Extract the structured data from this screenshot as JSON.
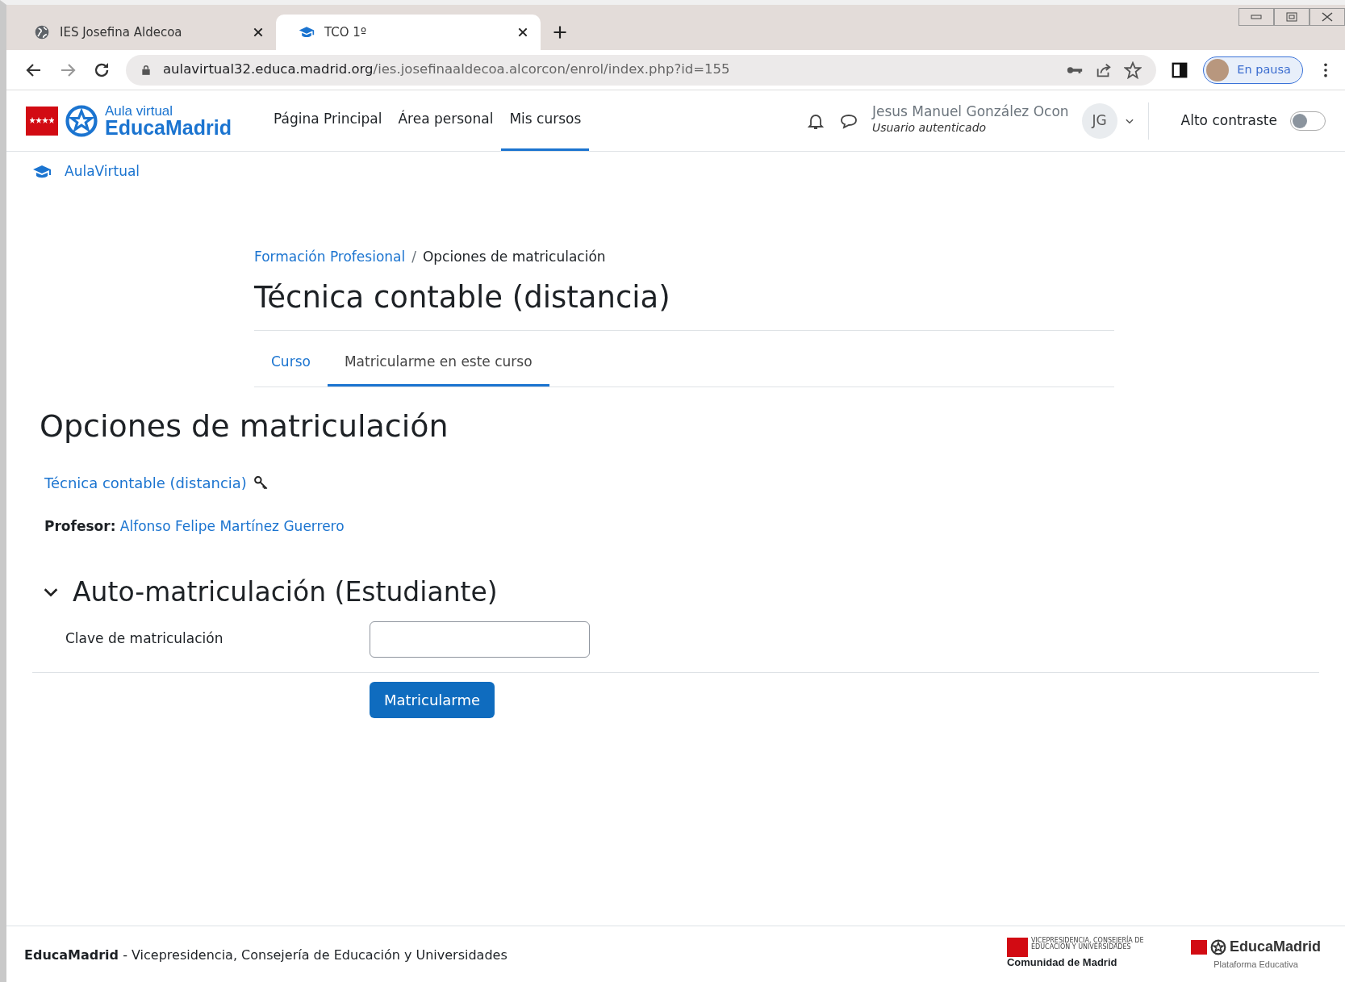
{
  "browser": {
    "tabs": [
      {
        "title": "IES Josefina Aldecoa",
        "selected": false
      },
      {
        "title": "TCO 1º",
        "selected": true
      }
    ],
    "address": {
      "host": "aulavirtual32.educa.madrid.org",
      "path": "/ies.josefinaaldecoa.alcorcon/enrol/index.php?id=155"
    },
    "profile_status": "En pausa"
  },
  "site": {
    "logo": {
      "line1": "Aula virtual",
      "line2": "EducaMadrid"
    },
    "nav": [
      {
        "label": "Página Principal",
        "selected": false
      },
      {
        "label": "Área personal",
        "selected": false
      },
      {
        "label": "Mis cursos",
        "selected": true
      }
    ],
    "user": {
      "name": "Jesus Manuel González Ocon",
      "role": "Usuario autenticado",
      "initials": "JG"
    },
    "contrast": {
      "label": "Alto contraste",
      "on": false
    }
  },
  "secondary_link": "AulaVirtual",
  "breadcrumb": [
    {
      "label": "Formación Profesional",
      "link": true
    },
    {
      "label": "Opciones de matriculación",
      "link": false
    }
  ],
  "breadcrumb_separator": "/",
  "course_title": "Técnica contable (distancia)",
  "course_tabs": [
    {
      "label": "Curso",
      "selected": false
    },
    {
      "label": "Matricularme en este curso",
      "selected": true
    }
  ],
  "heading": "Opciones de matriculación",
  "course_link": "Técnica contable (distancia)",
  "teacher": {
    "label": "Profesor:",
    "name": "Alfonso Felipe Martínez Guerrero"
  },
  "enrolment": {
    "title": "Auto-matriculación (Estudiante)",
    "expanded": true,
    "field_label": "Clave de matriculación",
    "button": "Matricularme"
  },
  "footer": {
    "text": "**EducaMadrid** - Vicepresidencia, Consejería de Educación y Universidades",
    "logo_left": {
      "small": "VICEPRESIDENCIA, CONSEJERÍA DE EDUCACIÓN Y UNIVERSIDADES",
      "big": "Comunidad de Madrid"
    },
    "logo_right": {
      "big": "EducaMadrid",
      "small": "Plataforma Educativa"
    }
  }
}
